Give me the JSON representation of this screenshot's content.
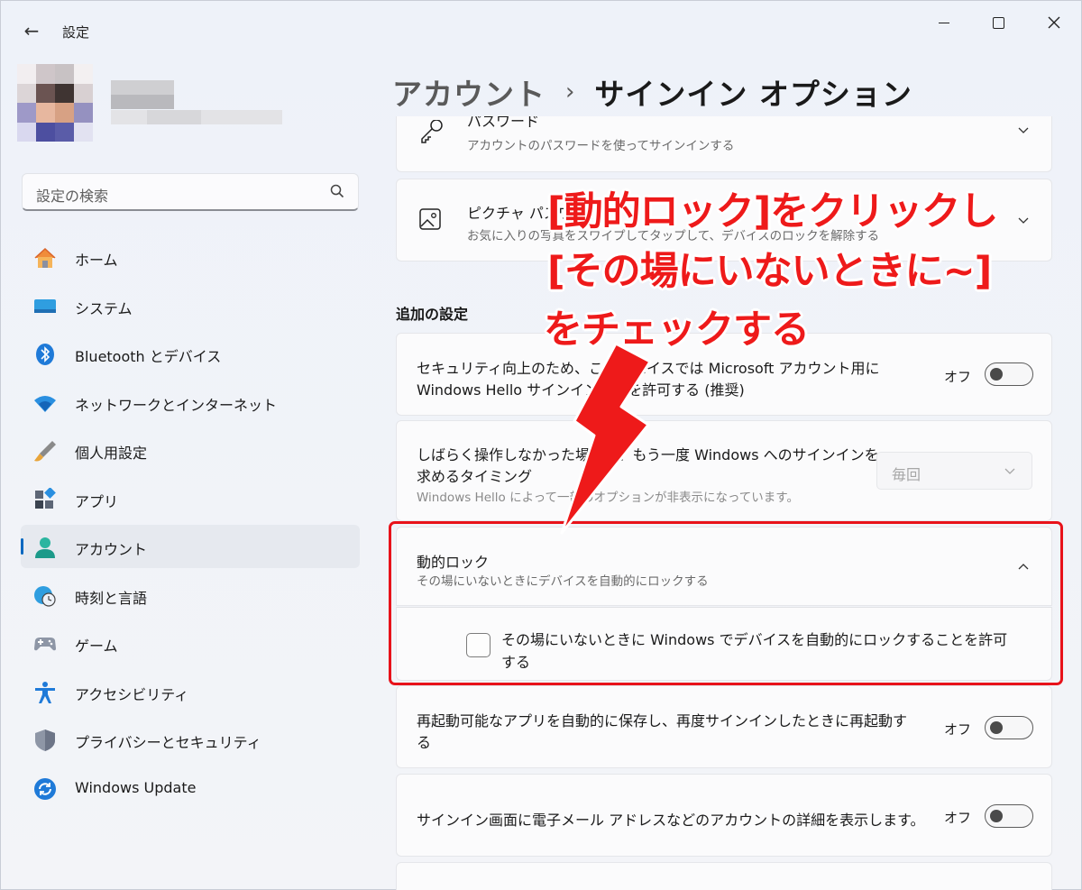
{
  "window": {
    "app_title": "設定",
    "back_label": "←"
  },
  "search": {
    "placeholder": "設定の検索"
  },
  "sidebar": {
    "items": [
      {
        "label": "ホーム",
        "icon": "home-icon",
        "active": false
      },
      {
        "label": "システム",
        "icon": "system-icon",
        "active": false
      },
      {
        "label": "Bluetooth とデバイス",
        "icon": "bluetooth-icon",
        "active": false
      },
      {
        "label": "ネットワークとインターネット",
        "icon": "wifi-icon",
        "active": false
      },
      {
        "label": "個人用設定",
        "icon": "brush-icon",
        "active": false
      },
      {
        "label": "アプリ",
        "icon": "apps-icon",
        "active": false
      },
      {
        "label": "アカウント",
        "icon": "account-icon",
        "active": true
      },
      {
        "label": "時刻と言語",
        "icon": "clock-globe-icon",
        "active": false
      },
      {
        "label": "ゲーム",
        "icon": "gamepad-icon",
        "active": false
      },
      {
        "label": "アクセシビリティ",
        "icon": "accessibility-icon",
        "active": false
      },
      {
        "label": "プライバシーとセキュリティ",
        "icon": "shield-icon",
        "active": false
      },
      {
        "label": "Windows Update",
        "icon": "update-icon",
        "active": false
      }
    ]
  },
  "breadcrumb": {
    "parent": "アカウント",
    "separator": "›",
    "current": "サインイン オプション"
  },
  "cards": {
    "password": {
      "title": "パスワード",
      "subtitle": "アカウントのパスワードを使ってサインインする"
    },
    "picture_password": {
      "title": "ピクチャ パスワード",
      "subtitle": "お気に入りの写真をスワイプしてタップして、デバイスのロックを解除する"
    },
    "section_title": "追加の設定",
    "hello_only": {
      "title_line1": "セキュリティ向上のため、このデバイスでは Microsoft アカウント用に",
      "title_line2": "Windows Hello サインインのみを許可する (推奨)",
      "toggle_label": "オフ",
      "toggle_on": false
    },
    "signin_timing": {
      "title_line1": "しばらく操作しなかった場合に、もう一度 Windows へのサインインを",
      "title_line2": "求めるタイミング",
      "subtitle": "Windows Hello によって一部のオプションが非表示になっています。",
      "dropdown_value": "毎回"
    },
    "dynamic_lock": {
      "title": "動的ロック",
      "subtitle": "その場にいないときにデバイスを自動的にロックする",
      "checkbox_label_line1": "その場にいないときに Windows でデバイスを自動的にロックすることを許可",
      "checkbox_label_line2": "する",
      "checked": false
    },
    "restart_apps": {
      "title_line1": "再起動可能なアプリを自動的に保存し、再度サインインしたときに再起動す",
      "title_line2": "る",
      "toggle_label": "オフ",
      "toggle_on": false
    },
    "account_details": {
      "title": "サインイン画面に電子メール アドレスなどのアカウントの詳細を表示します。",
      "toggle_label": "オフ",
      "toggle_on": false
    }
  },
  "annotation": {
    "line1": "[動的ロック]をクリックし",
    "line2": "[その場にいないときに~]",
    "line3": "をチェックする",
    "color": "#ee1a1a"
  },
  "colors": {
    "accent": "#0067c0",
    "annotation_red": "#e8121a"
  }
}
